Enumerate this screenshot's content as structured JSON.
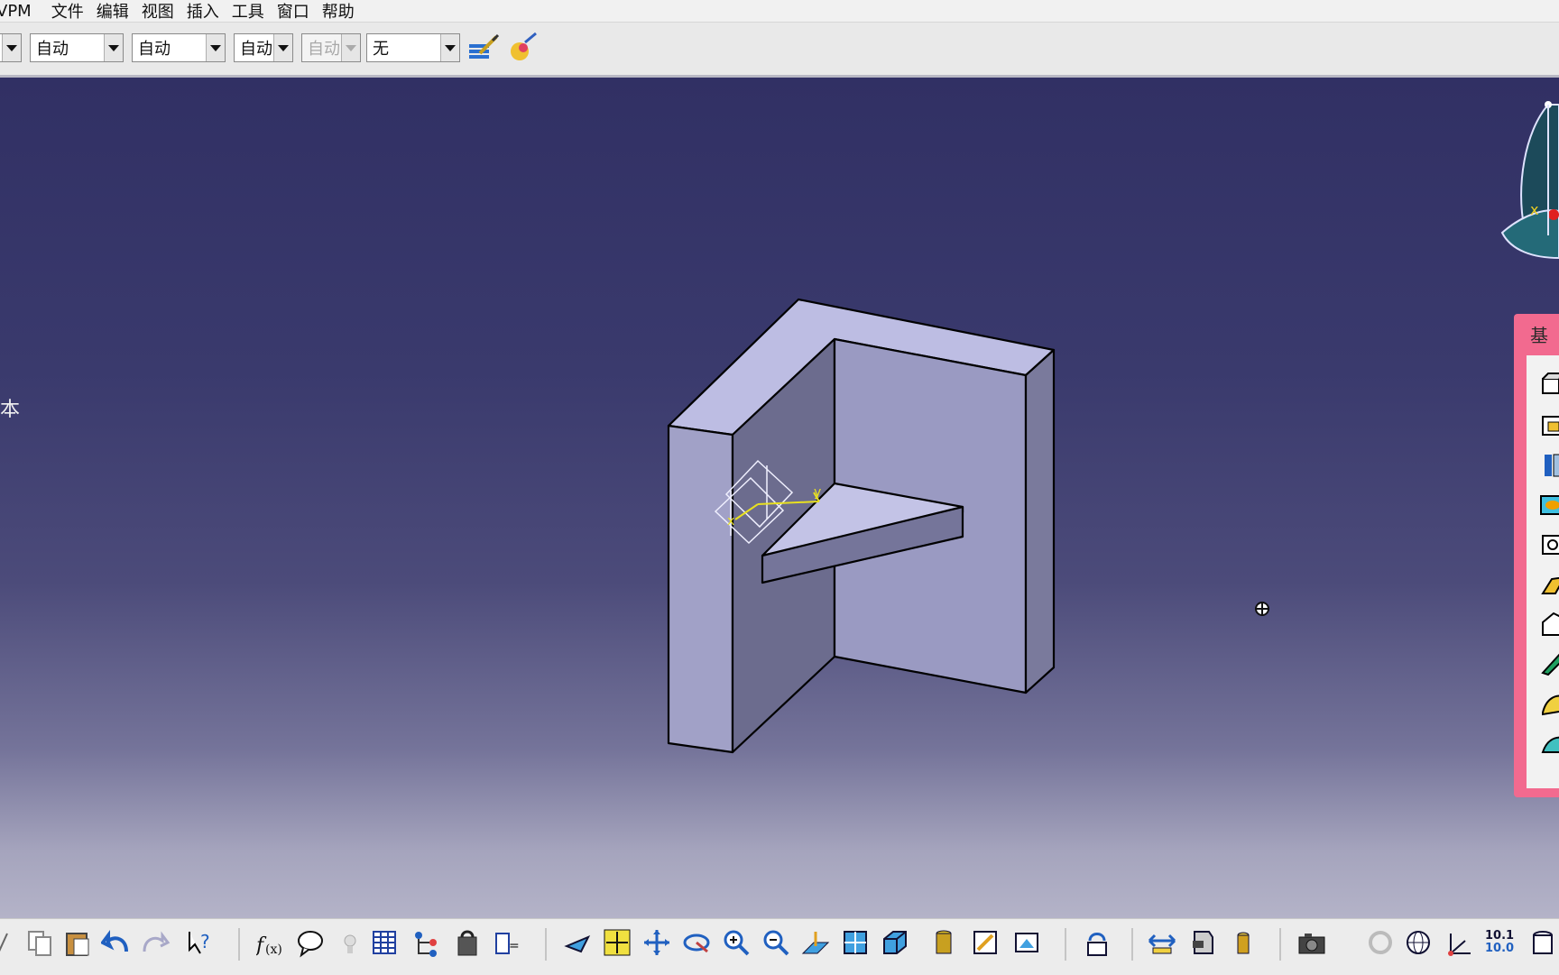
{
  "menu": [
    "VPM",
    "文件",
    "编辑",
    "视图",
    "插入",
    "工具",
    "窗口",
    "帮助"
  ],
  "toolbar": {
    "combo1": "自动",
    "combo2": "自动",
    "combo3": "自动",
    "combo4": "自动",
    "combo5": "无"
  },
  "viewport": {
    "edge_label": "本",
    "compass": {
      "x_label": "x",
      "y_label": "y"
    },
    "axis_labels": {
      "y": "y",
      "x": "x"
    }
  },
  "right_panel": {
    "title": "基"
  },
  "bottom": {
    "scale_top": "10.1",
    "scale_bottom": "10.0"
  },
  "colors": {
    "part_face_light": "#bdbde3",
    "part_face_mid": "#9c9cc4",
    "part_face_dark": "#6b6b8c",
    "panel_border": "#f26a8f"
  }
}
